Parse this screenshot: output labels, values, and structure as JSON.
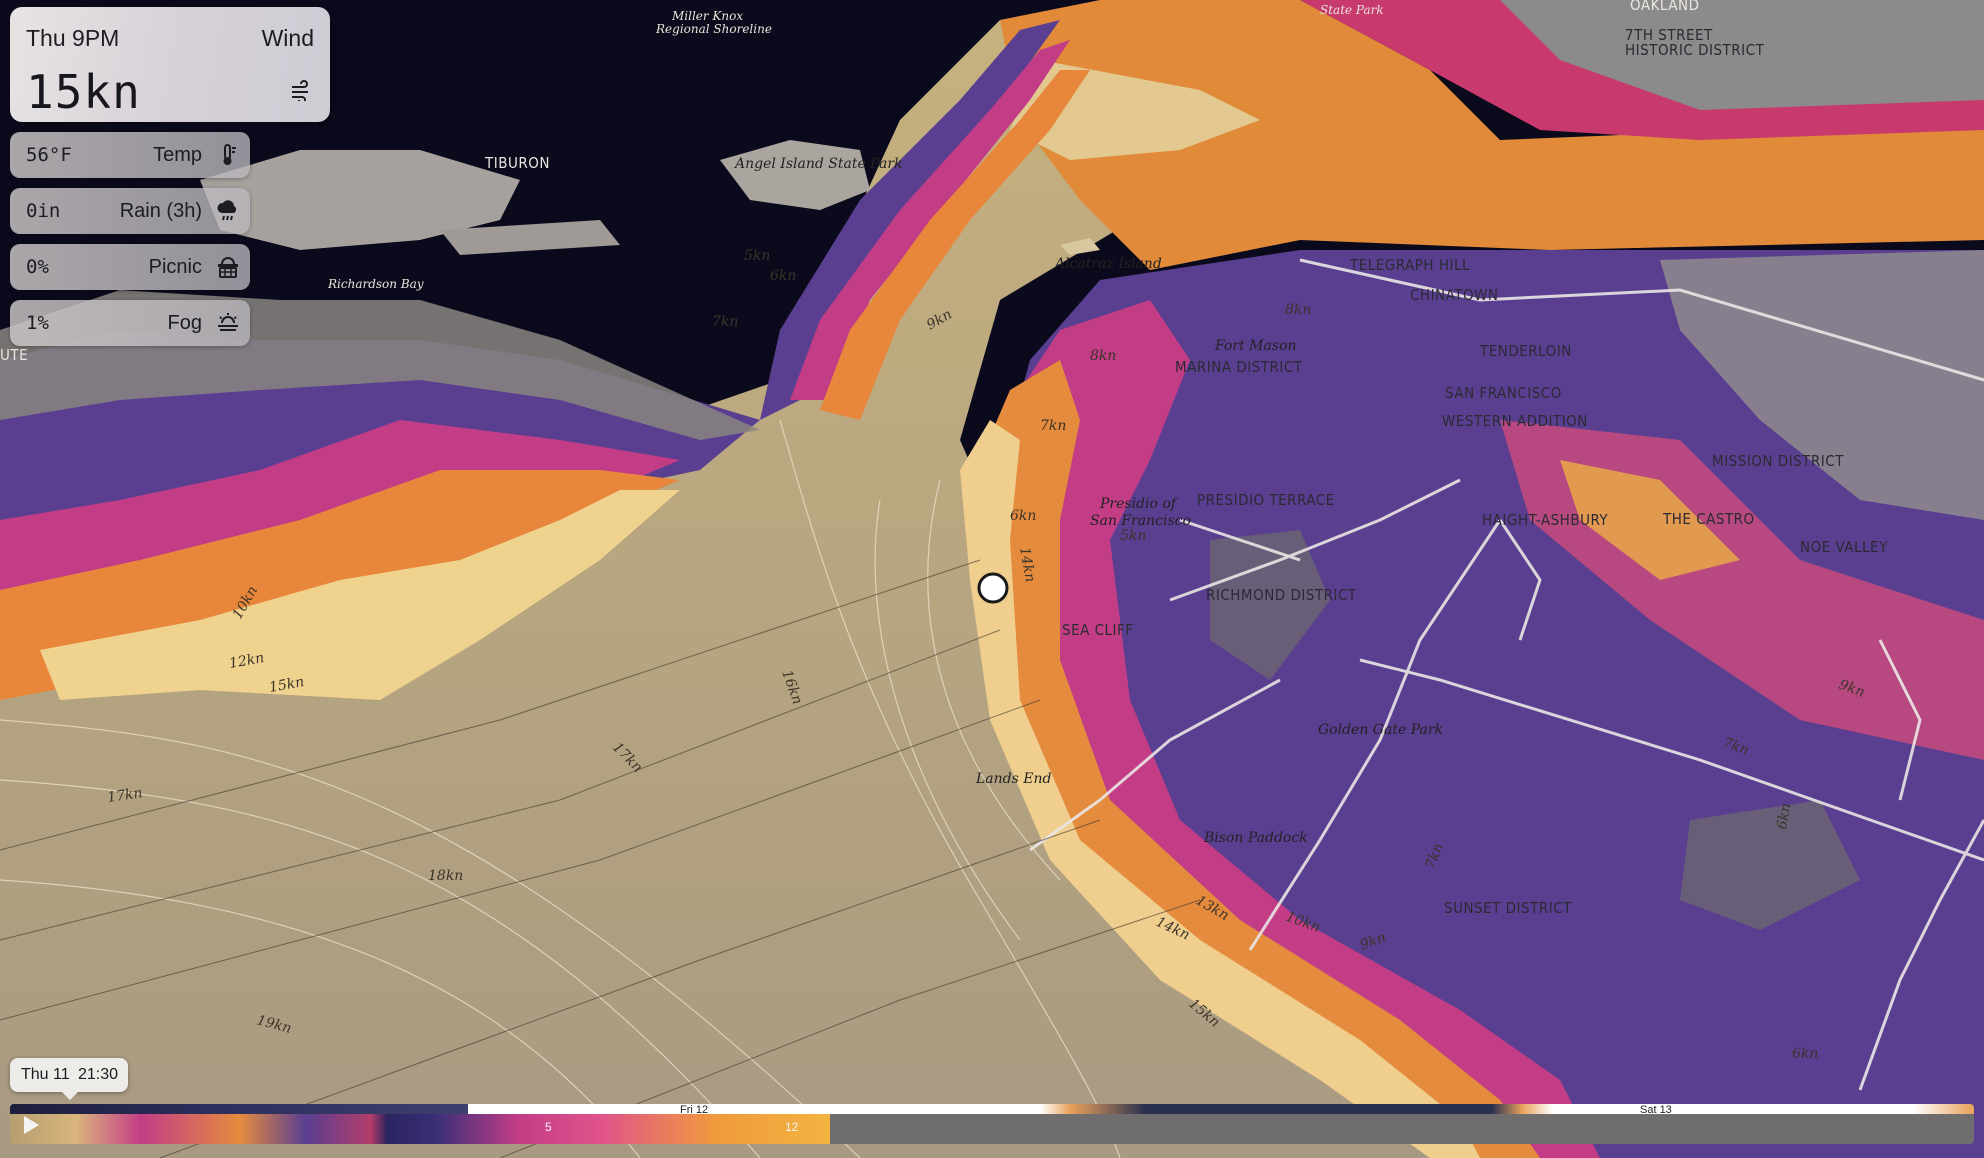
{
  "weather_card": {
    "time": "Thu 9PM",
    "metric": "Wind",
    "value": "15kn",
    "icon": "wind-icon"
  },
  "stats": [
    {
      "value": "56°F",
      "label": "Temp",
      "icon": "thermometer-icon"
    },
    {
      "value": "0in",
      "label": "Rain (3h)",
      "icon": "rain-cloud-icon"
    },
    {
      "value": "0%",
      "label": "Picnic",
      "icon": "picnic-basket-icon"
    },
    {
      "value": "1%",
      "label": "Fog",
      "icon": "fog-icon"
    }
  ],
  "timeline": {
    "day": "Thu 11",
    "time": "21:30",
    "day_labels": [
      "Fri 12",
      "Sat 13"
    ],
    "scale_labels": [
      "5",
      "12"
    ],
    "play_icon": "play-icon"
  },
  "map": {
    "places": [
      "OAKLAND",
      "7TH STREET",
      "HISTORIC DISTRICT",
      "TIBURON",
      "Angel Island State Park",
      "Richardson Bay",
      "Alcatraz Island",
      "TELEGRAPH HILL",
      "CHINATOWN",
      "TENDERLOIN",
      "Fort Mason",
      "MARINA DISTRICT",
      "SAN FRANCISCO",
      "WESTERN ADDITION",
      "MISSION DISTRICT",
      "Presidio of",
      "San Francisco",
      "PRESIDIO TERRACE",
      "HAIGHT-ASHBURY",
      "THE CASTRO",
      "NOE VALLEY",
      "RICHMOND DISTRICT",
      "SEA CLIFF",
      "Golden Gate Park",
      "Lands End",
      "Bison Paddock",
      "SUNSET DISTRICT",
      "Miller Knox",
      "Regional Shoreline",
      "State Park",
      "UTE"
    ],
    "contours": [
      "10kn",
      "12kn",
      "15kn",
      "17kn",
      "17kn",
      "18kn",
      "19kn",
      "16kn",
      "14kn",
      "14kn",
      "15kn",
      "13kn",
      "10kn",
      "9kn",
      "7kn",
      "7kn",
      "6kn",
      "9kn",
      "7kn",
      "6kn",
      "8kn",
      "5kn",
      "6kn",
      "7kn",
      "9kn",
      "8kn",
      "7kn",
      "6kn",
      "5kn"
    ]
  },
  "colors": {
    "water_dark": "#0b0a1c",
    "calm_sea": "#b9a27a",
    "strong": "#ec9a3c",
    "medium": "#d6417a",
    "low": "#4f3b8c",
    "land": "#8e8a86"
  }
}
